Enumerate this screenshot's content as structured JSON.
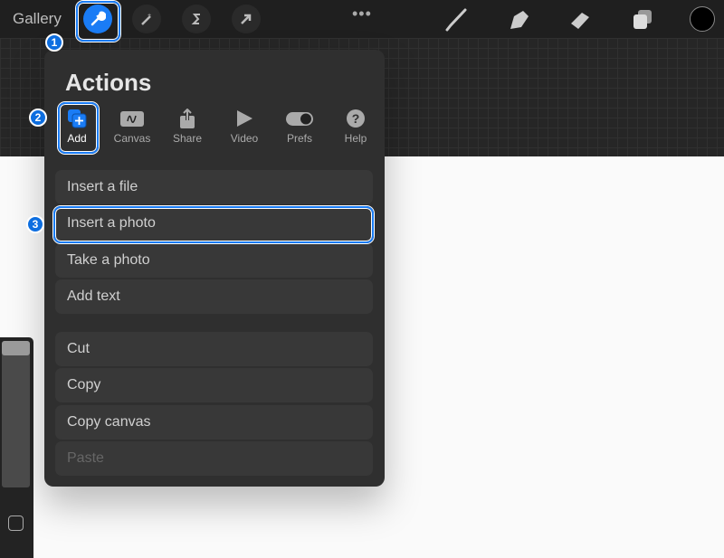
{
  "topbar": {
    "gallery": "Gallery",
    "more": "•••",
    "tools": [
      "wrench-icon",
      "magic-wand-icon",
      "selection-icon",
      "transform-arrow-icon"
    ],
    "right_tools": [
      "brush-icon",
      "smudge-icon",
      "eraser-icon",
      "layers-icon"
    ],
    "current_color": "#000000"
  },
  "actions": {
    "title": "Actions",
    "tabs": [
      {
        "label": "Add",
        "icon": "add-icon"
      },
      {
        "label": "Canvas",
        "icon": "canvas-icon"
      },
      {
        "label": "Share",
        "icon": "share-icon"
      },
      {
        "label": "Video",
        "icon": "video-icon"
      },
      {
        "label": "Prefs",
        "icon": "toggle-icon"
      },
      {
        "label": "Help",
        "icon": "help-icon"
      }
    ],
    "items": [
      "Insert a file",
      "Insert a photo",
      "Take a photo",
      "Add text"
    ],
    "edit_items": [
      "Cut",
      "Copy",
      "Copy canvas",
      "Paste"
    ]
  },
  "callouts": [
    "1",
    "2",
    "3"
  ],
  "colors": {
    "accent": "#1a7cf5",
    "panel": "#2f2f2f"
  }
}
